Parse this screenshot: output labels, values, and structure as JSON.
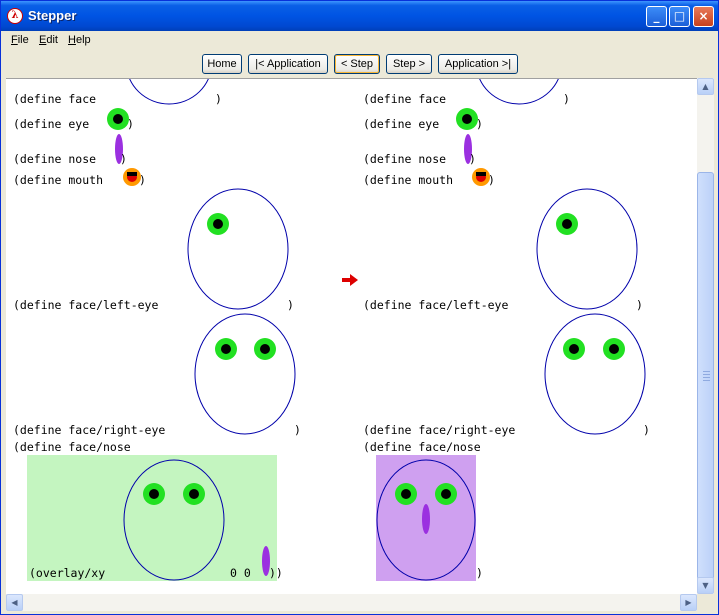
{
  "window": {
    "title": "Stepper",
    "app_icon": "racket-lambda-icon"
  },
  "title_buttons": {
    "minimize": "_",
    "maximize": "□",
    "close": "×"
  },
  "menu": [
    {
      "label": "File",
      "accel": "F",
      "rest": "ile"
    },
    {
      "label": "Edit",
      "accel": "E",
      "rest": "dit"
    },
    {
      "label": "Help",
      "accel": "H",
      "rest": "elp"
    }
  ],
  "toolbar": {
    "home": "Home",
    "first_application": "|< Application",
    "prev_step": "< Step",
    "next_step": "Step >",
    "last_application": "Application >|"
  },
  "step_arrow_color": "#dd0000",
  "left": {
    "define_face": "(define face",
    "define_eye": "(define eye",
    "define_nose": "(define nose",
    "define_mouth": "(define mouth",
    "define_face_left_eye": "(define face/left-eye",
    "define_face_right_eye": "(define face/right-eye",
    "define_face_nose": "(define face/nose",
    "overlay_xy": "(overlay/xy",
    "overlay_args": "0 0",
    "close_paren": ")",
    "close_double": "))"
  },
  "right": {
    "define_face": "(define face",
    "define_eye": "(define eye",
    "define_nose": "(define nose",
    "define_mouth": "(define mouth",
    "define_face_left_eye": "(define face/left-eye",
    "define_face_right_eye": "(define face/right-eye",
    "define_face_nose": "(define face/nose",
    "close_paren": ")"
  },
  "colors": {
    "eye_outer": "#22e022",
    "pupil": "#000000",
    "nose": "#9b30e0",
    "face_stroke": "#0000aa",
    "highlight_before": "#c4f5c0",
    "highlight_after": "#cfa0f0",
    "mouth_outer": "#ff9900",
    "mouth_inner": "#dd0000"
  }
}
